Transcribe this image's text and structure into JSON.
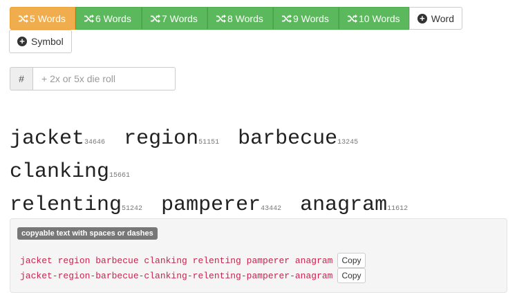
{
  "generate_buttons": [
    {
      "label": "5 Words",
      "icon": "shuffle-icon"
    },
    {
      "label": "6 Words",
      "icon": "shuffle-icon"
    },
    {
      "label": "7 Words",
      "icon": "shuffle-icon"
    },
    {
      "label": "8 Words",
      "icon": "shuffle-icon"
    },
    {
      "label": "9 Words",
      "icon": "shuffle-icon"
    },
    {
      "label": "10 Words",
      "icon": "shuffle-icon"
    }
  ],
  "add_word": {
    "label": "Word",
    "icon": "plus-circle-icon"
  },
  "add_symbol": {
    "label": "Symbol",
    "icon": "plus-circle-icon"
  },
  "dice_input": {
    "addon": "#",
    "placeholder": "+ 2x or 5x die roll",
    "value": ""
  },
  "passphrase": [
    {
      "word": "jacket",
      "roll": "34646"
    },
    {
      "word": "region",
      "roll": "51151"
    },
    {
      "word": "barbecue",
      "roll": "13245"
    },
    {
      "word": "clanking",
      "roll": "15661"
    },
    {
      "word": "relenting",
      "roll": "51242"
    },
    {
      "word": "pamperer",
      "roll": "43442"
    },
    {
      "word": "anagram",
      "roll": "11612"
    }
  ],
  "copy_panel": {
    "label": "copyable text with spaces or dashes",
    "spaces_text": "jacket region barbecue clanking relenting pamperer anagram",
    "dashes_text": "jacket-region-barbecue-clanking-relenting-pamperer-anagram",
    "copy_label": "Copy"
  },
  "colors": {
    "warning": "#f0ad4e",
    "success": "#5cb85c",
    "code_text": "#c7254e",
    "well_bg": "#f5f5f5",
    "label_bg": "#777777"
  }
}
